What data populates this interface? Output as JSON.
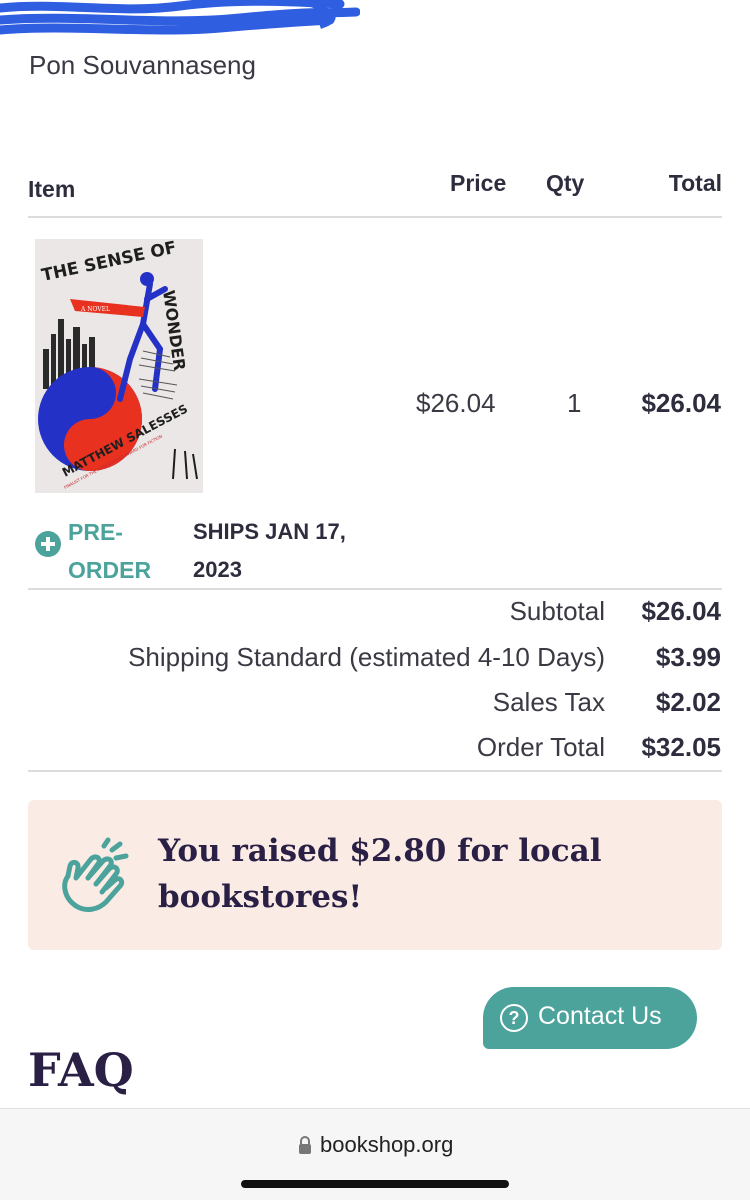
{
  "customer": {
    "name": "Pon Souvannaseng"
  },
  "table": {
    "headers": {
      "item": "Item",
      "price": "Price",
      "qty": "Qty",
      "total": "Total"
    }
  },
  "item": {
    "cover": {
      "title_line1": "THE SENSE OF",
      "title_line2": "WONDER",
      "author": "MATTHEW SALESSES",
      "tag": "A NOVEL",
      "finalist": "FINALIST FOR THE PEN/FAULKNER AWARD FOR FICTION"
    },
    "price": "$26.04",
    "qty": "1",
    "total": "$26.04",
    "preorder_label": "PRE-ORDER",
    "ships": "SHIPS JAN 17, 2023"
  },
  "summary": {
    "subtotal_label": "Subtotal",
    "subtotal_value": "$26.04",
    "shipping_label": "Shipping Standard (estimated 4-10 Days)",
    "shipping_value": "$3.99",
    "tax_label": "Sales Tax",
    "tax_value": "$2.02",
    "order_total_label": "Order Total",
    "order_total_value": "$32.05"
  },
  "banner": {
    "text": "You raised $2.80 for local bookstores!",
    "icon": "clapping-hands-icon"
  },
  "contact": {
    "label": "Contact Us",
    "icon": "question-circle-icon",
    "icon_glyph": "?"
  },
  "faq": {
    "heading": "FAQ"
  },
  "browser": {
    "url": "bookshop.org",
    "icon": "lock-icon"
  },
  "colors": {
    "accent": "#4ba39c",
    "banner_bg": "#fbebe5",
    "heading": "#2a1f44",
    "redaction": "#2f5ee0"
  }
}
